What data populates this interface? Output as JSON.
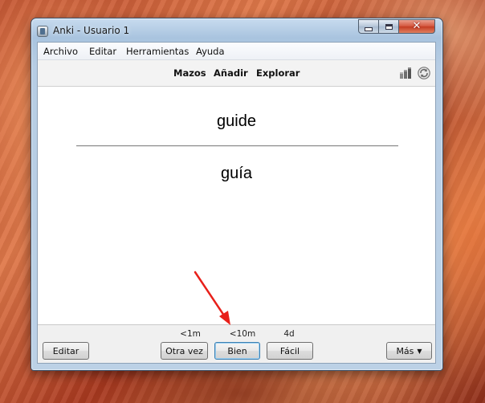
{
  "window": {
    "title": "Anki - Usuario 1",
    "close_glyph": "✕"
  },
  "menubar": {
    "items": [
      "Archivo",
      "Editar",
      "Herramientas",
      "Ayuda"
    ]
  },
  "toolbar": {
    "links": [
      "Mazos",
      "Añadir",
      "Explorar"
    ],
    "icons": [
      "stats-icon",
      "sync-icon"
    ]
  },
  "card": {
    "front": "guide",
    "back": "guía"
  },
  "answer_bar": {
    "edit_label": "Editar",
    "buttons": [
      {
        "label": "Otra vez",
        "interval": "<1m"
      },
      {
        "label": "Bien",
        "interval": "<10m"
      },
      {
        "label": "Fácil",
        "interval": "4d"
      }
    ],
    "more_label": "Más",
    "more_caret": "▼"
  },
  "colors": {
    "annotation_arrow": "#e8201a",
    "default_button_border": "#3c7fb1"
  }
}
